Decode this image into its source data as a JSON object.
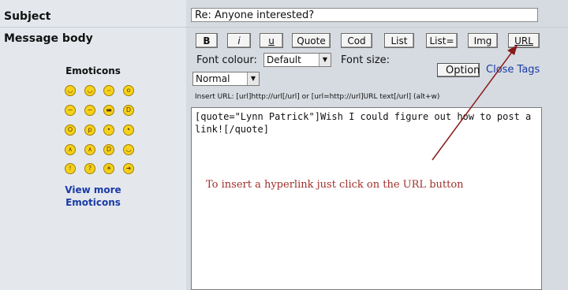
{
  "form": {
    "subject_label": "Subject",
    "subject_value": "Re: Anyone interested?",
    "message_label": "Message body"
  },
  "toolbar": {
    "bold": "B",
    "italic": "i",
    "underline": "u",
    "quote": "Quote",
    "code": "Cod",
    "list": "List",
    "list_ordered": "List=",
    "img": "Img",
    "url": "URL"
  },
  "font": {
    "colour_label": "Font colour:",
    "colour_value": "Default",
    "size_label": "Font size:",
    "size_value": "Normal"
  },
  "options_button": "Option",
  "close_tags": "Close Tags",
  "insert_hint": "Insert URL: [url]http://url[/url] or [url=http://url]URL text[/url]  (alt+w)",
  "message_text": "[quote=\"Lynn Patrick\"]Wish I could figure out how to post a link![/quote]",
  "annotation": {
    "text": "To insert a hyperlink just click on the URL button",
    "color": "#a1302a"
  },
  "emoticons": {
    "title": "Emoticons",
    "icons": [
      "smile",
      "biggrin",
      "sad",
      "surprised",
      "confused",
      "neutral",
      "cool",
      "lol",
      "eek",
      "razz",
      "rolleyes",
      "wink",
      "evil",
      "twisted",
      "mrgreen",
      "smile-alt",
      "exclaim",
      "question",
      "idea",
      "arrow"
    ],
    "view_more_line1": "View more",
    "view_more_line2": "Emoticons"
  },
  "colors": {
    "link": "#1a3aa6",
    "left_panel": "#e4e8ed",
    "right_panel": "#d6dbe1"
  }
}
